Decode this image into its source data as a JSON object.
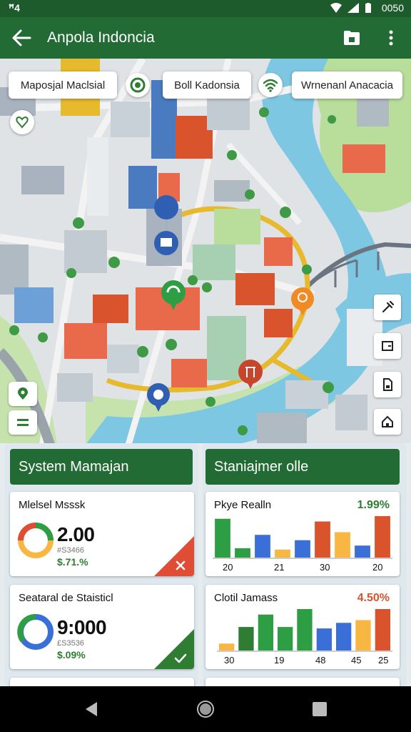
{
  "status_bar": {
    "left": "ꟸ4",
    "time": "0050"
  },
  "app_bar": {
    "title": "Anpola Indoncia"
  },
  "map": {
    "labels": [
      "Maposjal Maclsial",
      "Boll Kadonsia",
      "Wrnenanl Anacacia"
    ]
  },
  "panels": {
    "left_header": "System Mamajan",
    "right_header": "Staniajmer olle"
  },
  "cards": {
    "c1": {
      "title": "Mlelsel Msssk",
      "value": "2.00",
      "sub": "#S3466",
      "pct": "$.71.%"
    },
    "c2": {
      "title": "Seataral de Staisticl",
      "value": "9:000",
      "sub": "£S3536",
      "pct": "$.09%"
    },
    "c3": {
      "title": "Pkye Realln",
      "pct": "1.99%",
      "ticks": [
        "20",
        "21",
        "30",
        "20"
      ]
    },
    "c4": {
      "title": "Clotil Jamass",
      "pct": "4.50%",
      "ticks": [
        "30",
        "19",
        "48",
        "45",
        "25"
      ]
    }
  },
  "chart_data": [
    {
      "type": "bar",
      "title": "Pkye Realln",
      "values": [
        58,
        14,
        34,
        12,
        26,
        54,
        38,
        18,
        62
      ],
      "colors": [
        "#2e9e44",
        "#2e9e44",
        "#3a6fd8",
        "#f7b742",
        "#3a6fd8",
        "#d9542c",
        "#f7b742",
        "#3a6fd8",
        "#d9542c"
      ],
      "x_ticks": [
        "20",
        "21",
        "30",
        "20"
      ]
    },
    {
      "type": "bar",
      "title": "Clotil Jamass",
      "values": [
        10,
        34,
        52,
        34,
        60,
        32,
        40,
        44,
        60
      ],
      "colors": [
        "#f7b742",
        "#2e7d32",
        "#2e9e44",
        "#2e9e44",
        "#2e9e44",
        "#3a6fd8",
        "#3a6fd8",
        "#f7b742",
        "#d9542c"
      ],
      "x_ticks": [
        "30",
        "19",
        "48",
        "45",
        "25"
      ]
    }
  ],
  "colors": {
    "primary": "#236b34",
    "accent_red": "#e04d35",
    "accent_green": "#2e7d32"
  }
}
